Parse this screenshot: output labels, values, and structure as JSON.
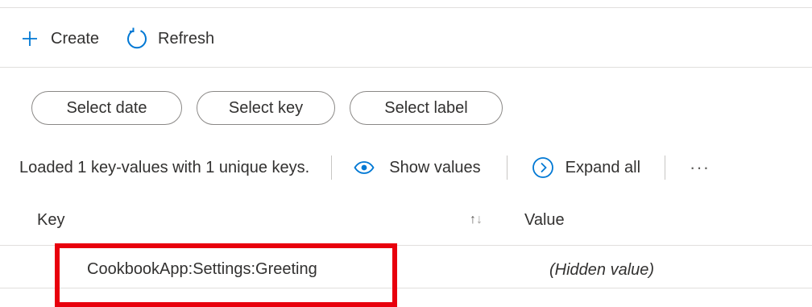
{
  "toolbar": {
    "create_label": "Create",
    "refresh_label": "Refresh",
    "icons": {
      "create": "plus-icon",
      "refresh": "refresh-icon"
    }
  },
  "filters": {
    "date_label": "Select date",
    "key_label": "Select key",
    "label_label": "Select label"
  },
  "status": {
    "message": "Loaded 1 key-values with 1 unique keys.",
    "show_values_label": "Show values",
    "expand_all_label": "Expand all",
    "more_label": "···",
    "icons": {
      "show_values": "eye-icon",
      "expand_all": "chevron-right-circle-icon",
      "more": "ellipsis-icon"
    }
  },
  "table": {
    "columns": {
      "key": "Key",
      "sort": "↑↓",
      "value": "Value"
    },
    "rows": [
      {
        "key": "CookbookApp:Settings:Greeting",
        "value": "(Hidden value)"
      }
    ]
  },
  "colors": {
    "accent": "#0078d4",
    "highlight": "#e8000d",
    "text": "#323130",
    "border": "#e1dfdd"
  }
}
